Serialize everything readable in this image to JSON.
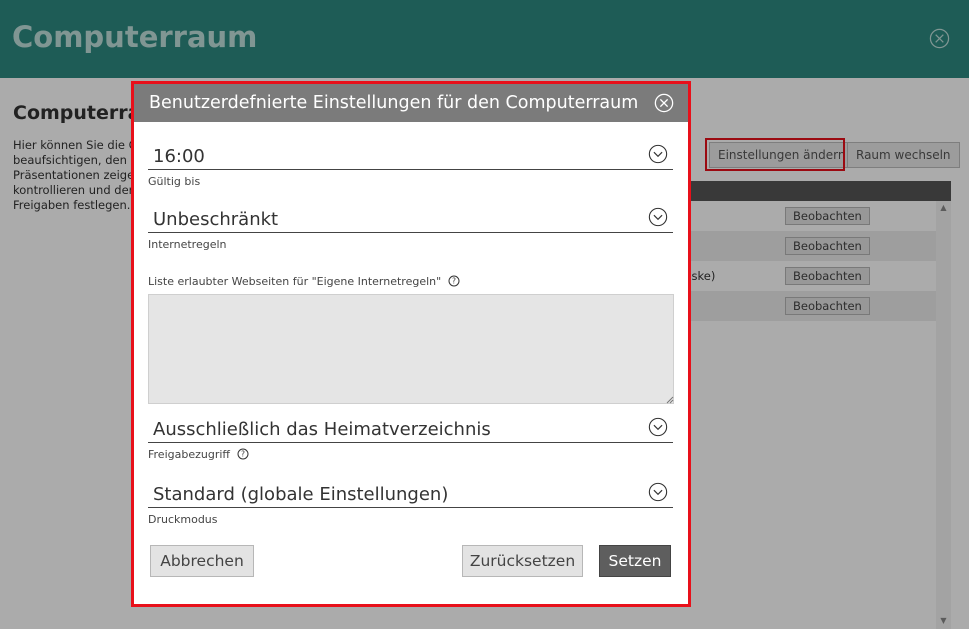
{
  "app": {
    "title": "Computerraum",
    "close_icon": "circle-x-icon"
  },
  "page": {
    "heading": "Computerra",
    "description_lines": [
      "Hier können Sie die C",
      "beaufsichtigen, den Z",
      "Präsentationen zeige",
      "kontrollieren und der",
      "Freigaben festlegen."
    ],
    "buttons": {
      "settings_label": "Einstellungen ändern",
      "change_room_label": "Raum wechseln"
    },
    "rows": [
      {
        "text": "",
        "watch_label": "Beobachten"
      },
      {
        "text": "",
        "watch_label": "Beobachten"
      },
      {
        "text": "röske)",
        "watch_label": "Beobachten"
      },
      {
        "text": "",
        "watch_label": "Beobachten"
      }
    ]
  },
  "dialog": {
    "title": "Benutzerdefnierte Einstellungen für den Computerraum",
    "close_icon": "circle-x-icon",
    "valid_until": {
      "value": "16:00",
      "label": "Gültig bis"
    },
    "internet_rules": {
      "value": "Unbeschränkt",
      "label": "Internetregeln"
    },
    "allowed_sites": {
      "label": "Liste erlaubter Webseiten für \"Eigene Internetregeln\"",
      "value": ""
    },
    "share_access": {
      "value": "Ausschließlich das Heimatverzeichnis",
      "label": "Freigabezugriff"
    },
    "print_mode": {
      "value": "Standard (globale Einstellungen)",
      "label": "Druckmodus"
    },
    "buttons": {
      "cancel": "Abbrechen",
      "reset": "Zurücksetzen",
      "set": "Setzen"
    }
  },
  "colors": {
    "header_teal": "#2d8a80",
    "dialog_header": "#7b7b7b",
    "highlight_red": "#e8101a",
    "primary_button": "#5e5e5e"
  }
}
